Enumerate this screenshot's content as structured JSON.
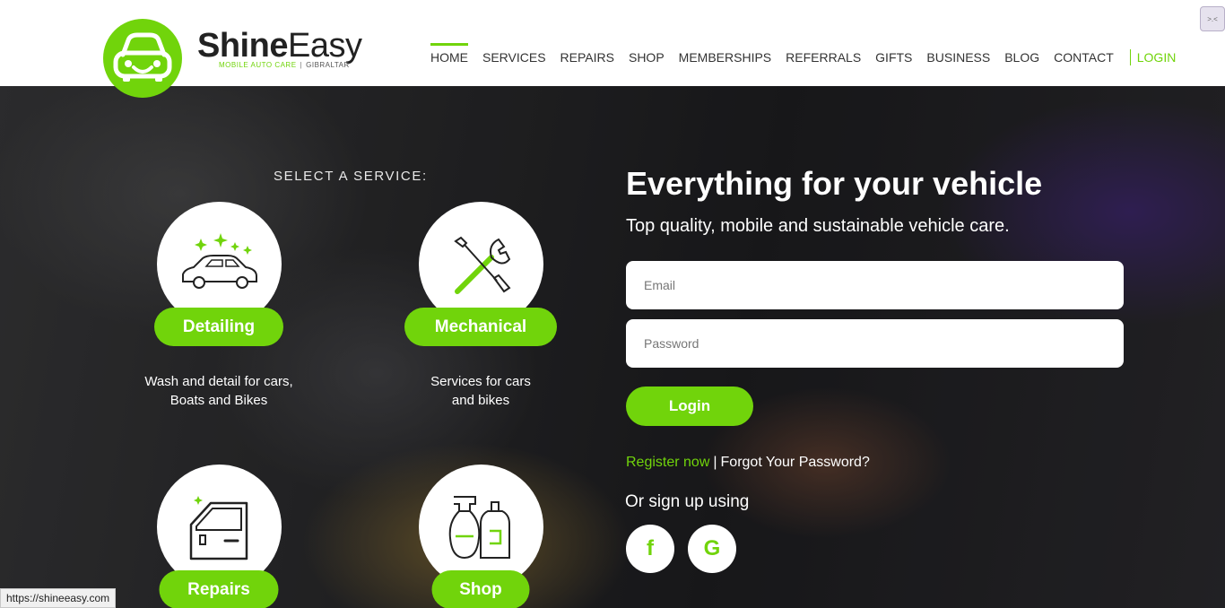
{
  "brand": {
    "name_part1": "Shine",
    "name_part2": "Easy",
    "tagline": "MOBILE AUTO CARE",
    "location": "GIBRALTAR",
    "accent_color": "#71d40b"
  },
  "nav": {
    "items": [
      {
        "label": "HOME",
        "active": true
      },
      {
        "label": "SERVICES"
      },
      {
        "label": "REPAIRS"
      },
      {
        "label": "SHOP"
      },
      {
        "label": "MEMBERSHIPS"
      },
      {
        "label": "REFERRALS"
      },
      {
        "label": "GIFTS"
      },
      {
        "label": "BUSINESS"
      },
      {
        "label": "BLOG"
      },
      {
        "label": "CONTACT"
      }
    ],
    "login_label": "LOGIN"
  },
  "services": {
    "heading": "SELECT A SERVICE:",
    "items": [
      {
        "label": "Detailing",
        "icon": "car-sparkle-icon",
        "desc_line1": "Wash and detail for cars,",
        "desc_line2": "Boats and Bikes"
      },
      {
        "label": "Mechanical",
        "icon": "wrench-screwdriver-icon",
        "desc_line1": "Services for cars",
        "desc_line2": "and bikes"
      },
      {
        "label": "Repairs",
        "icon": "car-door-icon"
      },
      {
        "label": "Shop",
        "icon": "spray-bottle-icon"
      }
    ]
  },
  "hero": {
    "title": "Everything for your vehicle",
    "subtitle": "Top quality, mobile and sustainable vehicle care."
  },
  "login_form": {
    "email_placeholder": "Email",
    "password_placeholder": "Password",
    "submit_label": "Login",
    "register_label": "Register now",
    "separator": "|",
    "forgot_label": "Forgot Your Password?",
    "social_heading": "Or sign up using",
    "social": [
      {
        "glyph": "f",
        "icon": "facebook-icon"
      },
      {
        "glyph": "G",
        "icon": "google-icon"
      }
    ]
  },
  "status_bar": {
    "url": "https://shineeasy.com"
  }
}
